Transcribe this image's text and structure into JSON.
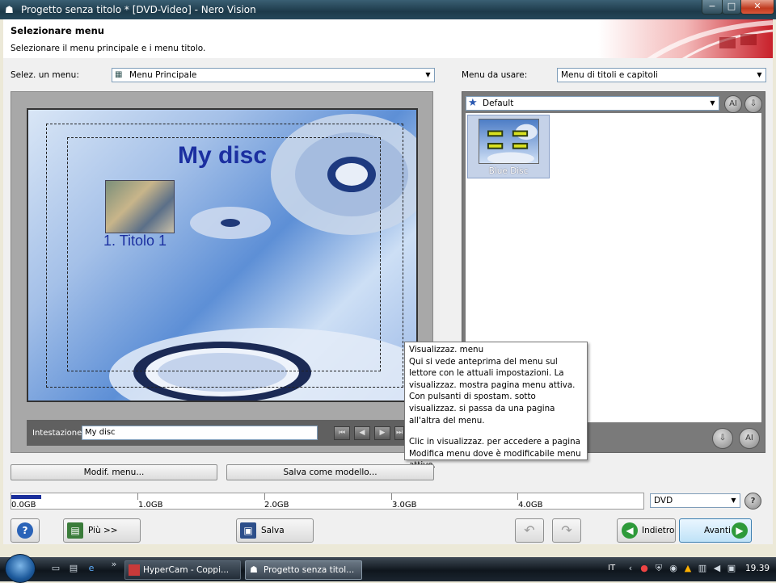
{
  "window": {
    "title": "Progetto senza titolo * [DVD-Video] - Nero Vision",
    "minimize": "−",
    "maximize": "□",
    "close": "✕"
  },
  "header": {
    "title": "Selezionare menu",
    "subtitle": "Selezionare il menu principale e i menu titolo."
  },
  "left_panel": {
    "select_label": "Selez. un menu:",
    "select_value": "Menu Principale",
    "preview": {
      "title": "My disc",
      "item_label": "1. Titolo 1"
    },
    "heading_label": "Intestazione:",
    "heading_value": "My disc"
  },
  "right_panel": {
    "menu_label": "Menu da usare:",
    "menu_value": "Menu di titoli e capitoli",
    "category_value": "Default",
    "templates": [
      {
        "label": "Blue Disc"
      }
    ]
  },
  "tooltip": {
    "title": "Visualizzaz. menu",
    "para1": "Qui si vede anteprima del menu sul lettore con le attuali impostazioni. La visualizzaz. mostra pagina menu attiva. Con pulsanti di spostam. sotto visualizzaz. si passa da una pagina all'altra del menu.",
    "para2": "Clic in visualizzaz. per accedere a pagina Modifica menu dove è modificabile menu attivo."
  },
  "actions": {
    "edit_menu": "Modif. menu...",
    "save_template": "Salva come modello..."
  },
  "capacity": {
    "labels": [
      "0.0GB",
      "1.0GB",
      "2.0GB",
      "3.0GB",
      "4.0GB"
    ],
    "disc_type": "DVD",
    "used_fraction": 0.05
  },
  "footer": {
    "more": "Più >>",
    "save": "Salva",
    "back": "Indietro",
    "next": "Avanti"
  },
  "taskbar": {
    "tasks": [
      {
        "label": "HyperCam - Coppi..."
      },
      {
        "label": "Progetto senza titol..."
      }
    ],
    "language": "IT",
    "clock": "19.39"
  }
}
